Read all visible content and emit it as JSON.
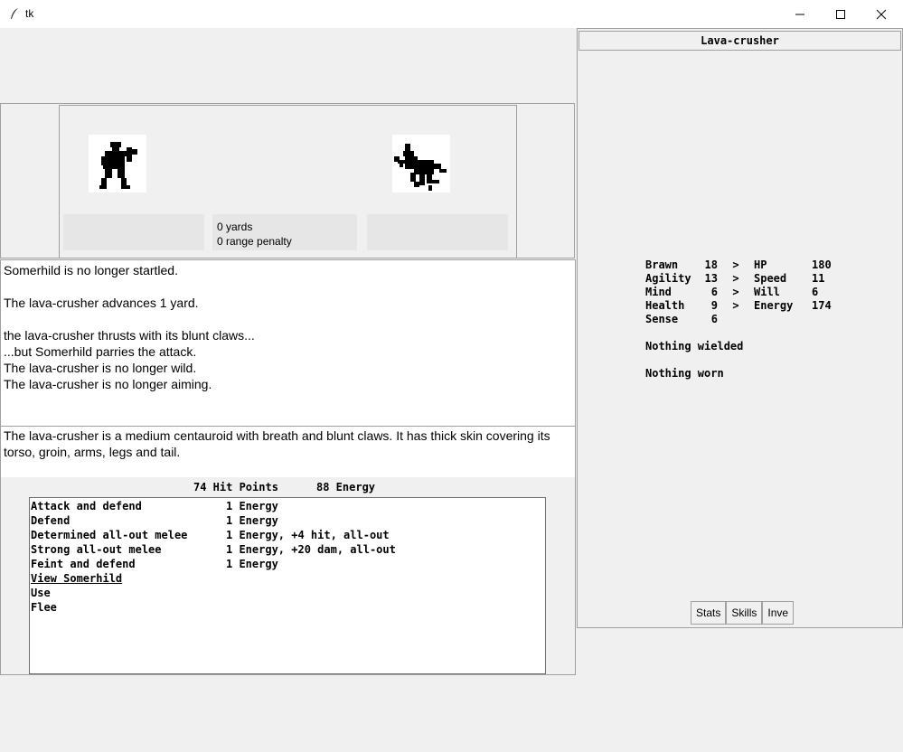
{
  "window": {
    "title": "tk"
  },
  "battle": {
    "distance": "0 yards",
    "range_penalty": "0 range penalty"
  },
  "log": [
    "Somerhild is no longer startled.",
    "",
    "The lava-crusher advances 1 yard.",
    "",
    "the lava-crusher thrusts with its blunt claws...",
    "...but Somerhild parries the attack.",
    "The lava-crusher is no longer wild.",
    "The lava-crusher is no longer aiming."
  ],
  "description": "The lava-crusher is a medium  centauroid with breath and blunt claws. It has thick skin covering its torso, groin, arms, legs and tail.",
  "status": {
    "hit_points": "74 Hit Points",
    "energy": "88 Energy"
  },
  "actions": [
    {
      "name": "Attack and defend",
      "cost": "1 Energy"
    },
    {
      "name": "Defend",
      "cost": "1 Energy"
    },
    {
      "name": "Determined all-out melee",
      "cost": "1 Energy, +4 hit, all-out"
    },
    {
      "name": "Strong all-out melee",
      "cost": "1 Energy, +20 dam, all-out"
    },
    {
      "name": "Feint and defend",
      "cost": "1 Energy"
    },
    {
      "name": "View Somerhild",
      "cost": ""
    },
    {
      "name": "Use",
      "cost": ""
    },
    {
      "name": "Flee",
      "cost": ""
    }
  ],
  "creature": {
    "name": "Lava-crusher",
    "stats": [
      {
        "attr": "Brawn",
        "val": "18",
        "arrow": ">",
        "derived": "HP",
        "dval": "180"
      },
      {
        "attr": "Agility",
        "val": "13",
        "arrow": ">",
        "derived": "Speed",
        "dval": "11"
      },
      {
        "attr": "Mind",
        "val": "6",
        "arrow": ">",
        "derived": "Will",
        "dval": "6"
      },
      {
        "attr": "Health",
        "val": "9",
        "arrow": ">",
        "derived": "Energy",
        "dval": "174"
      },
      {
        "attr": "Sense",
        "val": "6",
        "arrow": "",
        "derived": "",
        "dval": ""
      }
    ],
    "wielded": "Nothing wielded",
    "worn": "Nothing worn"
  },
  "tabs": [
    "Stats",
    "Skills",
    "Inve"
  ]
}
